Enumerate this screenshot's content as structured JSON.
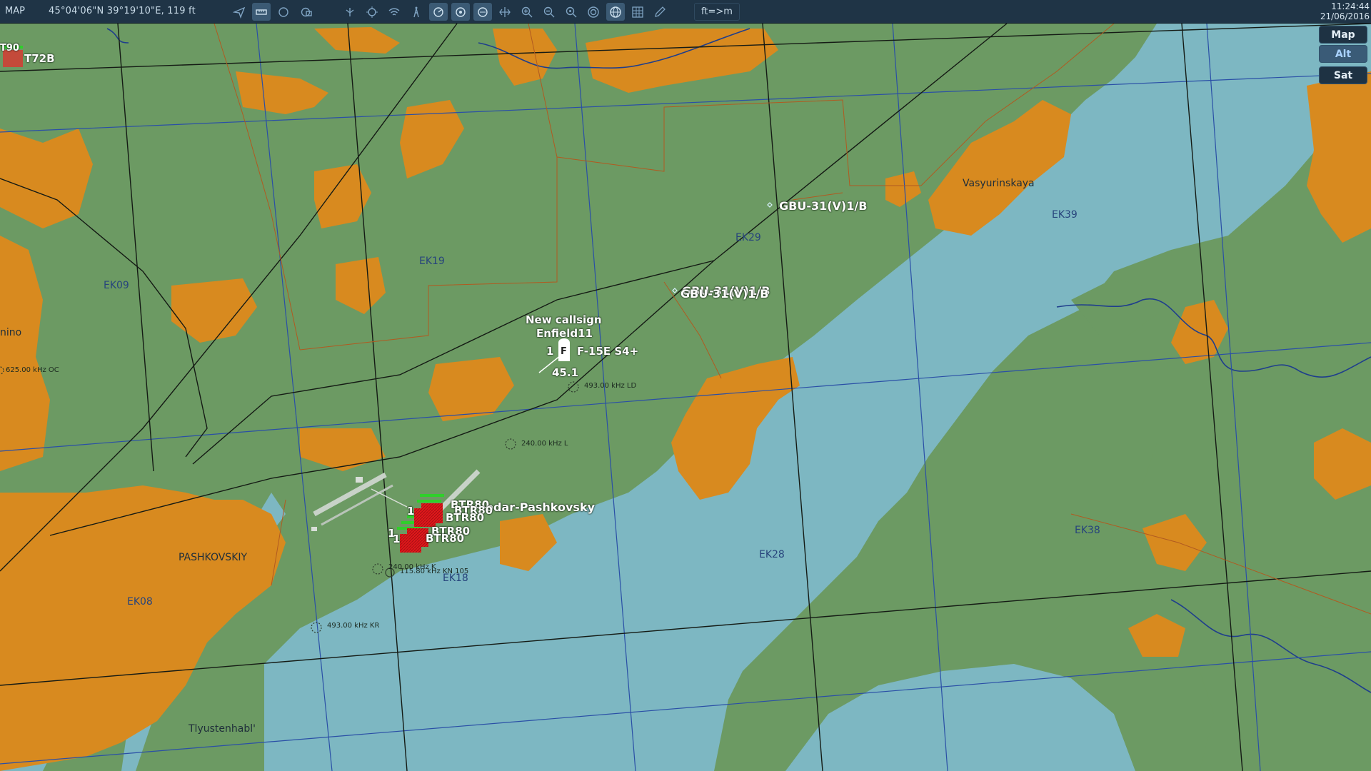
{
  "toolbar": {
    "mode": "MAP",
    "coordinates": "45°04'06\"N 39°19'10\"E, 119 ft",
    "units_toggle": "ft=>m",
    "time": "11:24:44",
    "date": "21/06/2016",
    "icons": [
      "send-icon",
      "ruler-icon",
      "circle-icon",
      "layers-icon",
      "waypoint-icon",
      "target-icon",
      "wifi-icon",
      "tower-icon",
      "radar-icon",
      "threat-icon",
      "threat-ring-icon",
      "grid-move-icon",
      "zoom-in-icon",
      "zoom-out-icon",
      "zoom-reset-icon",
      "compass-icon",
      "globe-icon",
      "grid-icon",
      "pencil-icon"
    ]
  },
  "layers": {
    "map": "Map",
    "alt": "Alt",
    "sat": "Sat",
    "active": "Alt"
  },
  "grid_labels": [
    "EK09",
    "EK19",
    "EK29",
    "EK39",
    "EK08",
    "EK18",
    "EK28",
    "EK38"
  ],
  "towns": {
    "vasyurinskaya": "Vasyurinskaya",
    "pashkovskiy": "PASHKOVSKIY",
    "tlyustenhabl": "Tlyustenhabl'",
    "nino": "nino"
  },
  "airbase": "odar-Pashkovsky",
  "ndbs": [
    {
      "freq": "625.00 kHz OC"
    },
    {
      "freq": "493.00 kHz LD"
    },
    {
      "freq": "240.00 kHz L"
    },
    {
      "freq": "493.00 kHz KR"
    },
    {
      "freq": "240.00 kHz K"
    },
    {
      "freq": "115.80 kHz KN 105"
    }
  ],
  "waypoints": {
    "gbu1": "GBU-31(V)1/B",
    "gbu2": "GBU-31(V)1/B",
    "gbu3": "GBU-31(V)1/B"
  },
  "player": {
    "callsign_line1": "New callsign",
    "callsign_line2": "Enfield11",
    "count": "1",
    "type": "F-15E S4+",
    "symbol": "F",
    "speed": "45.1"
  },
  "enemy_units": {
    "t72b": "T72B",
    "t90": "T90",
    "btr_a": "BTR80",
    "btr_b": "BTR80",
    "btr_c": "BTR80",
    "btr_d": "BTR80",
    "btr_e": "BTR80",
    "one_a": "1",
    "one_b": "1",
    "one_c": "1"
  },
  "colors": {
    "land": "#6c9a63",
    "water": "#7db7c2",
    "urban": "#d88a1f",
    "grid_blue": "#2a4fa6",
    "toolbar": "#1f3446",
    "enemy": "#e0171b",
    "friendly_box": "#2fd02a"
  }
}
